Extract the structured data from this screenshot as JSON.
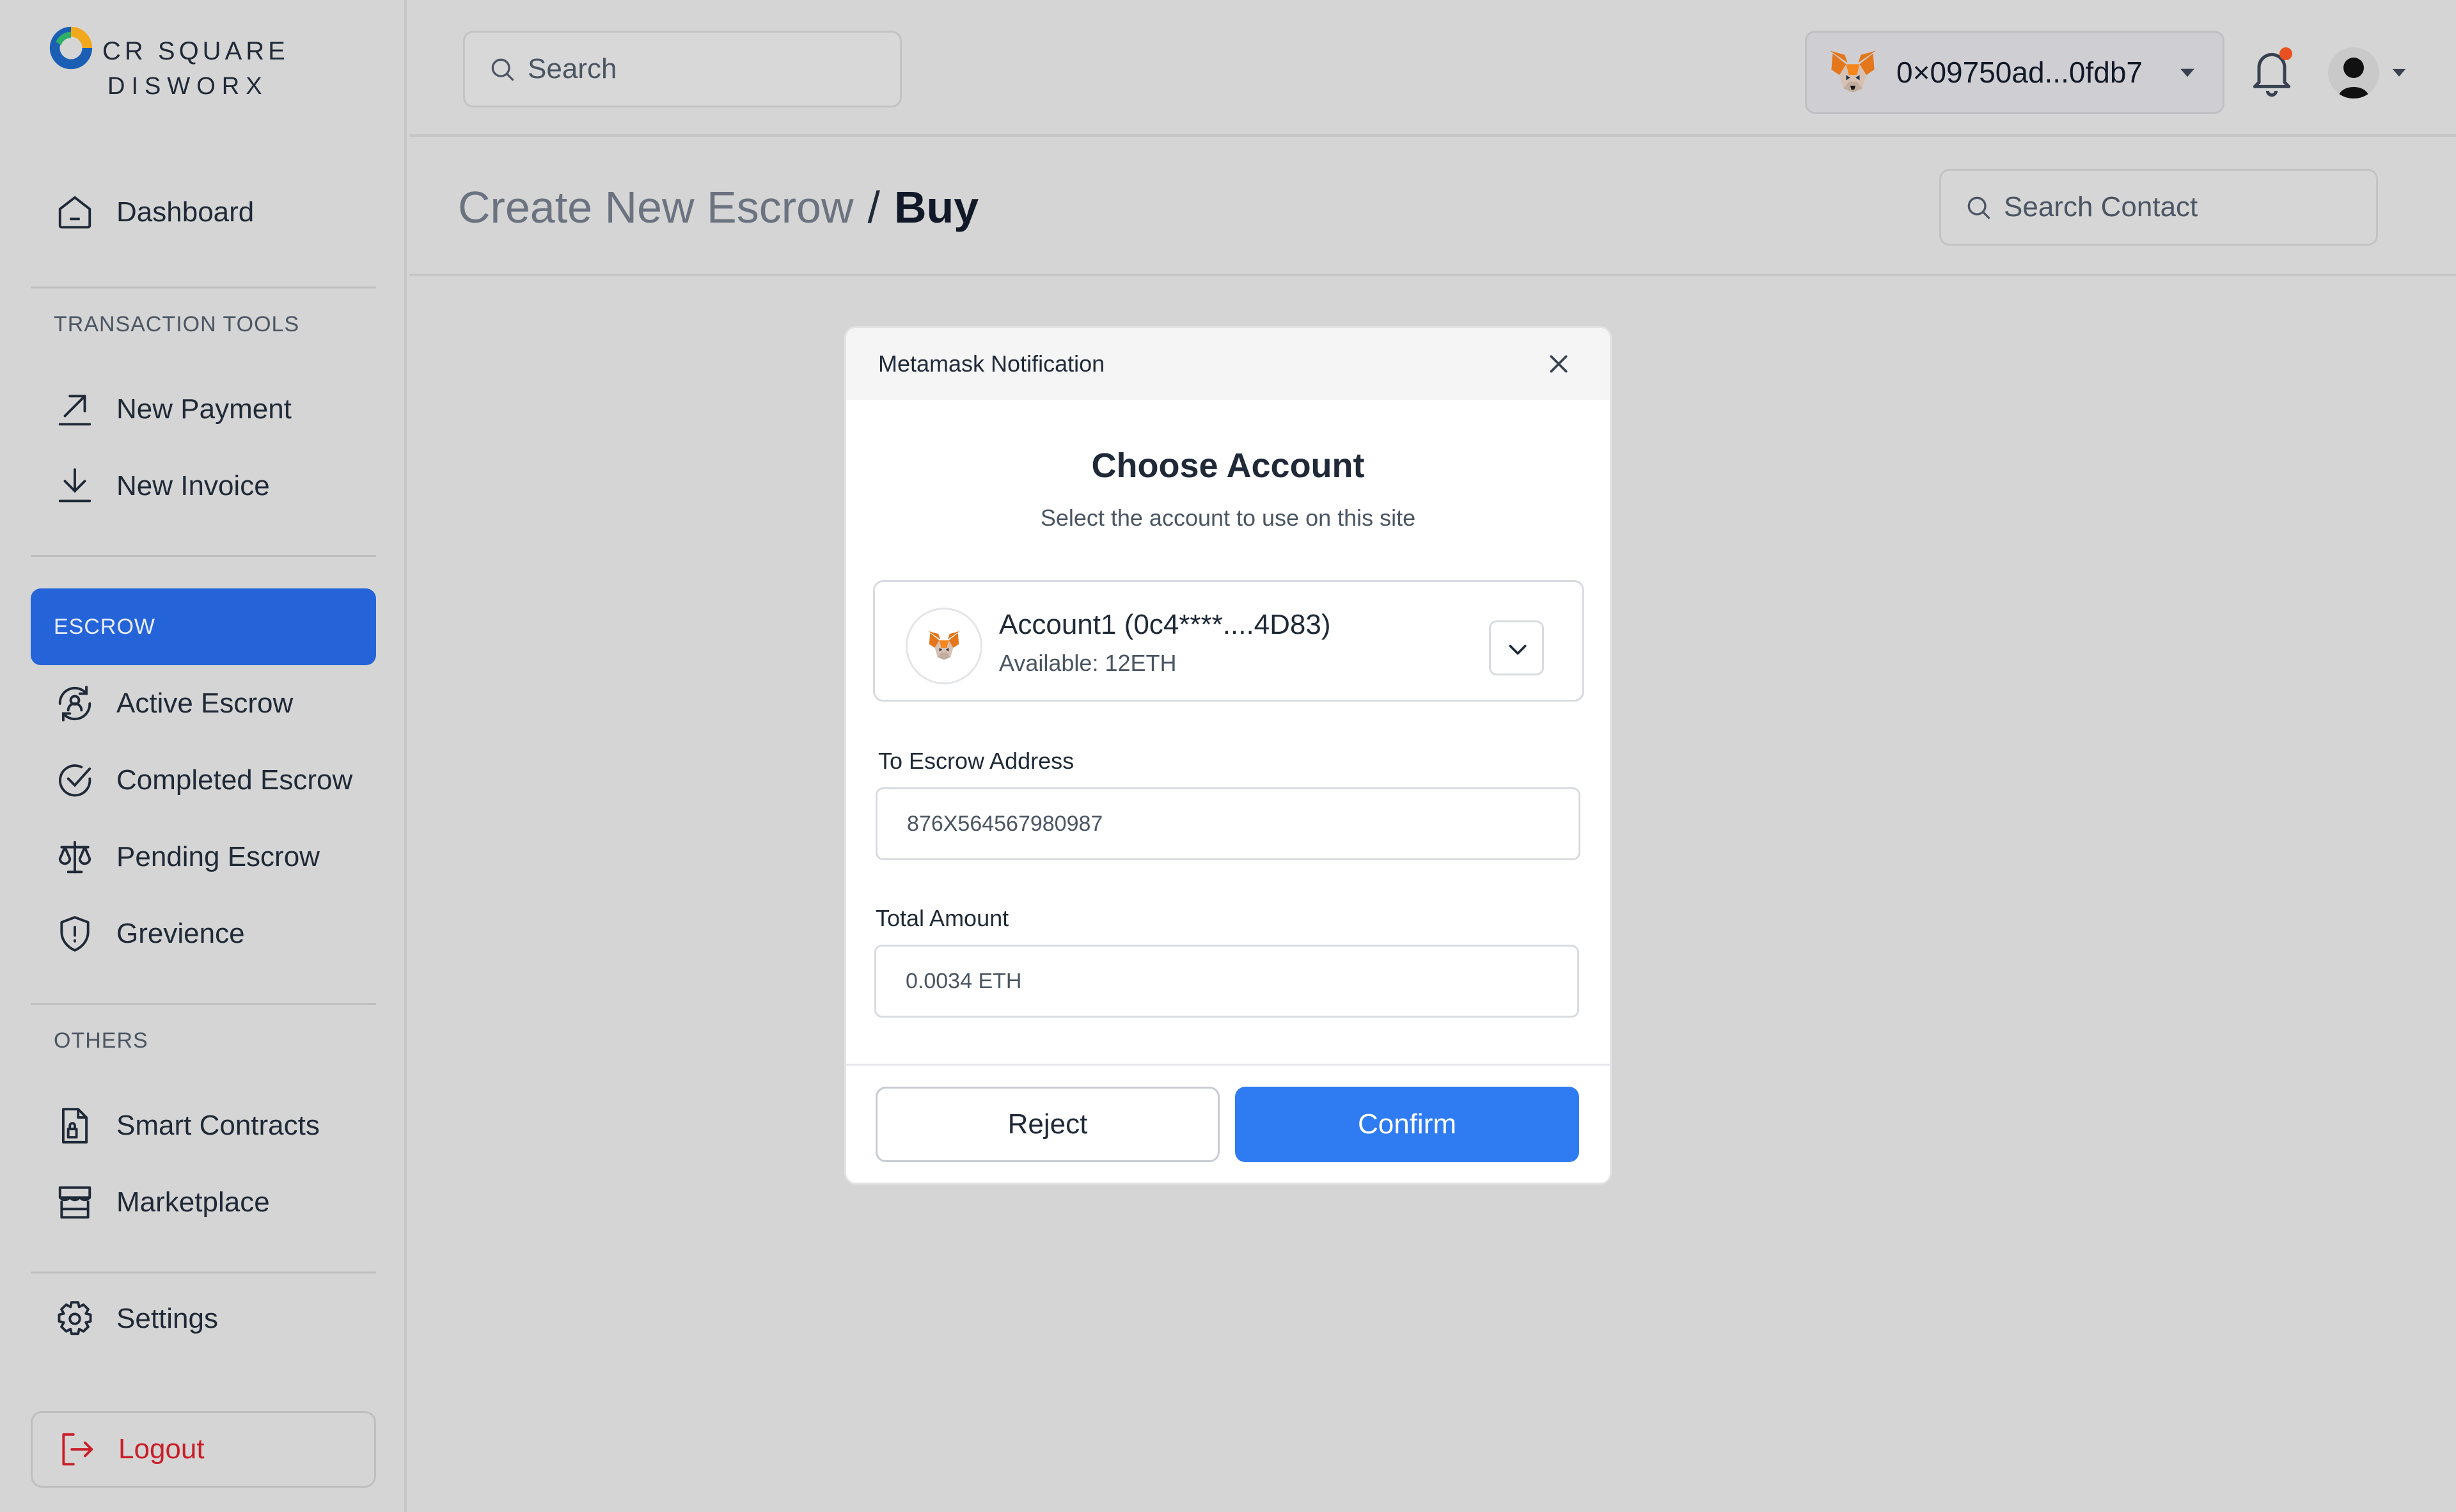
{
  "brand": {
    "line1": "CR SQUARE",
    "line2": "DISWORX"
  },
  "sidebar": {
    "dashboard": "Dashboard",
    "section_transaction": "TRANSACTION TOOLS",
    "new_payment": "New Payment",
    "new_invoice": "New Invoice",
    "escrow_header": "ESCROW",
    "active_escrow": "Active Escrow",
    "completed_escrow": "Completed Escrow",
    "pending_escrow": "Pending Escrow",
    "grevience": "Grevience",
    "section_others": "OTHERS",
    "smart_contracts": "Smart Contracts",
    "marketplace": "Marketplace",
    "settings": "Settings",
    "logout": "Logout"
  },
  "topbar": {
    "search_placeholder": "Search",
    "wallet_address": "0×09750ad...0fdb7"
  },
  "breadcrumb": {
    "parent": "Create New Escrow",
    "separator": "/",
    "current": "Buy"
  },
  "search_contact_placeholder": "Search Contact",
  "modal": {
    "header": "Metamask Notification",
    "title": "Choose Account",
    "subtitle": "Select the account to use on this site",
    "account_name": "Account1 (0c4****....4D83)",
    "account_available": "Available: 12ETH",
    "escrow_label": "To Escrow Address",
    "escrow_value": "876X564567980987",
    "amount_label": "Total Amount",
    "amount_value": "0.0034 ETH",
    "reject": "Reject",
    "confirm": "Confirm"
  },
  "colors": {
    "accent": "#2563d8",
    "confirm": "#2f7cf2",
    "logout": "#c81e28",
    "notification_dot": "#e8511f"
  },
  "icons": [
    "home-icon",
    "arrow-up-right-icon",
    "download-icon",
    "escrow-cycle-icon",
    "check-circle-icon",
    "scale-icon",
    "shield-alert-icon",
    "contract-icon",
    "store-icon",
    "gear-icon",
    "logout-icon",
    "search-icon",
    "metamask-fox-icon",
    "caret-down-icon",
    "bell-icon",
    "close-icon",
    "chevron-down-icon"
  ]
}
